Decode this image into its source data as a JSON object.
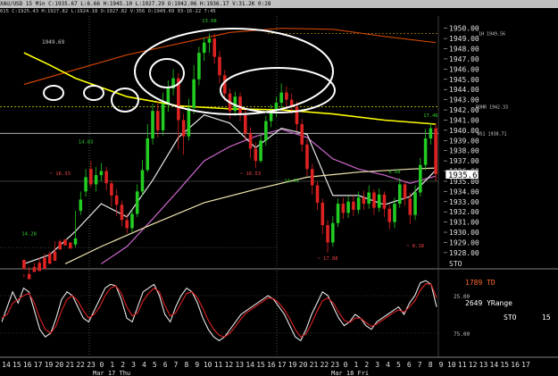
{
  "header": {
    "symbol_line": "XAU/USD 15 Min  C:1935.67  L:6.66  H:1945.10  L:1927.29  O:1942.06  H:1936.17  V:31.2K  0:28",
    "indicator_line": "615  C:1925.43  H:1927.82  L:1924.18  O:1927.82  V:356  O:1949.69  03-16-22  7:45"
  },
  "chart_data": [
    {
      "type": "candlestick",
      "yticks": [
        1950,
        1949,
        1948,
        1947,
        1946,
        1945,
        1944,
        1943,
        1942,
        1941,
        1940,
        1939,
        1938,
        1937,
        1936,
        1935,
        1934,
        1933,
        1932,
        1931,
        1930,
        1929,
        1928
      ],
      "ytick_labels": [
        "1950.00",
        "1949.00",
        "1948.00",
        "1947.00",
        "1946.00",
        "1945.00",
        "1944.00",
        "1943.00",
        "1942.00",
        "1941.00",
        "1940.00",
        "1939.00",
        "1938.00",
        "1937.00",
        "1936.00",
        "1935.00",
        "1934.00",
        "1933.00",
        "1932.00",
        "1931.00",
        "1930.00",
        "1929.00",
        "1928.00"
      ],
      "ylim": [
        1926.5,
        1951.2
      ],
      "last_price": "1935.67",
      "candles": [
        [
          1927.3,
          1926.4,
          1925.6,
          1925.9
        ],
        [
          1925.9,
          1925.4,
          1925.8,
          1926.6
        ],
        [
          1926.6,
          1926.1,
          1926.4,
          1927.0
        ],
        [
          1927.0,
          1926.2,
          1926.6,
          1927.5
        ],
        [
          1927.5,
          1926.4,
          1926.8,
          1927.9
        ],
        [
          1927.9,
          1926.9,
          1927.2,
          1928.1
        ],
        [
          1928.1,
          1927.2,
          1927.6,
          1929.1
        ],
        [
          1929.1,
          1928.3,
          1928.5,
          1929.3
        ],
        [
          1929.3,
          1928.7,
          1928.8,
          1929.0
        ],
        [
          1929.0,
          1928.4,
          1928.6,
          1928.8
        ],
        [
          1928.8,
          1929.4,
          1928.5,
          1932.1
        ],
        [
          1932.1,
          1933.2,
          1931.7,
          1934.0
        ],
        [
          1934.0,
          1935.4,
          1933.5,
          1936.2
        ],
        [
          1936.2,
          1934.7,
          1934.4,
          1937.0
        ],
        [
          1934.7,
          1935.6,
          1934.0,
          1936.4
        ],
        [
          1935.6,
          1936.0,
          1935.0,
          1936.8
        ],
        [
          1936.0,
          1934.8,
          1934.1,
          1936.4
        ],
        [
          1934.8,
          1933.6,
          1932.5,
          1935.1
        ],
        [
          1933.6,
          1932.7,
          1931.6,
          1934.2
        ],
        [
          1932.7,
          1931.2,
          1930.6,
          1933.1
        ],
        [
          1931.2,
          1930.4,
          1929.9,
          1931.8
        ],
        [
          1930.4,
          1931.8,
          1930.0,
          1932.2
        ],
        [
          1931.8,
          1934.0,
          1931.5,
          1934.7
        ],
        [
          1934.0,
          1936.1,
          1933.6,
          1937.1
        ],
        [
          1936.1,
          1939.2,
          1935.9,
          1940.6
        ],
        [
          1939.2,
          1941.9,
          1938.6,
          1942.6
        ],
        [
          1941.9,
          1940.0,
          1939.3,
          1942.8
        ],
        [
          1940.0,
          1942.6,
          1939.5,
          1943.7
        ],
        [
          1942.6,
          1944.1,
          1941.8,
          1944.9
        ],
        [
          1944.1,
          1945.1,
          1943.4,
          1946.0
        ],
        [
          1945.1,
          1941.0,
          1938.1,
          1945.6
        ],
        [
          1941.0,
          1939.4,
          1937.6,
          1941.6
        ],
        [
          1939.4,
          1942.2,
          1939.0,
          1943.1
        ],
        [
          1942.2,
          1945.0,
          1941.6,
          1946.4
        ],
        [
          1945.0,
          1947.6,
          1944.4,
          1948.2
        ],
        [
          1947.6,
          1948.6,
          1946.8,
          1949.1
        ],
        [
          1948.6,
          1949.0,
          1947.6,
          1949.5
        ],
        [
          1949.0,
          1947.2,
          1946.5,
          1949.5
        ],
        [
          1947.2,
          1945.4,
          1944.6,
          1947.8
        ],
        [
          1945.4,
          1943.6,
          1942.9,
          1945.9
        ],
        [
          1943.6,
          1941.9,
          1941.1,
          1944.1
        ],
        [
          1941.9,
          1943.3,
          1941.4,
          1943.8
        ],
        [
          1943.3,
          1941.5,
          1940.9,
          1943.7
        ],
        [
          1941.5,
          1939.7,
          1939.0,
          1942.0
        ],
        [
          1939.7,
          1938.2,
          1937.3,
          1940.3
        ],
        [
          1938.2,
          1937.0,
          1936.3,
          1938.8
        ],
        [
          1937.0,
          1939.0,
          1936.8,
          1939.6
        ],
        [
          1939.0,
          1940.9,
          1938.5,
          1941.4
        ],
        [
          1940.9,
          1941.9,
          1940.3,
          1942.5
        ],
        [
          1941.9,
          1942.7,
          1941.3,
          1943.3
        ],
        [
          1942.7,
          1943.7,
          1942.1,
          1944.6
        ],
        [
          1943.7,
          1943.0,
          1942.3,
          1944.3
        ],
        [
          1943.0,
          1942.3,
          1941.6,
          1943.6
        ],
        [
          1942.3,
          1940.6,
          1939.9,
          1942.8
        ],
        [
          1940.6,
          1938.6,
          1937.9,
          1941.1
        ],
        [
          1938.6,
          1936.2,
          1935.5,
          1939.1
        ],
        [
          1936.2,
          1934.6,
          1933.7,
          1936.7
        ],
        [
          1934.6,
          1932.9,
          1932.2,
          1935.0
        ],
        [
          1932.9,
          1930.7,
          1929.8,
          1933.3
        ],
        [
          1930.7,
          1929.0,
          1928.0,
          1931.2
        ],
        [
          1929.0,
          1930.9,
          1928.6,
          1931.6
        ],
        [
          1930.9,
          1932.8,
          1930.5,
          1933.3
        ],
        [
          1932.8,
          1931.9,
          1931.3,
          1933.4
        ],
        [
          1931.9,
          1933.0,
          1931.4,
          1933.5
        ],
        [
          1933.0,
          1932.2,
          1931.6,
          1933.6
        ],
        [
          1932.2,
          1933.4,
          1931.8,
          1934.0
        ],
        [
          1933.4,
          1932.8,
          1932.2,
          1934.1
        ],
        [
          1932.8,
          1933.9,
          1932.3,
          1934.6
        ],
        [
          1933.9,
          1932.4,
          1931.7,
          1934.2
        ],
        [
          1932.4,
          1933.7,
          1932.0,
          1934.3
        ],
        [
          1933.7,
          1932.3,
          1931.5,
          1934.0
        ],
        [
          1932.3,
          1931.0,
          1930.3,
          1932.7
        ],
        [
          1931.0,
          1932.8,
          1930.4,
          1933.4
        ],
        [
          1932.8,
          1934.7,
          1932.4,
          1935.3
        ],
        [
          1934.7,
          1933.3,
          1932.6,
          1935.0
        ],
        [
          1933.3,
          1931.7,
          1930.8,
          1933.9
        ],
        [
          1931.7,
          1933.9,
          1931.2,
          1934.6
        ],
        [
          1933.9,
          1936.6,
          1933.5,
          1937.3
        ],
        [
          1936.6,
          1939.2,
          1936.1,
          1940.1
        ],
        [
          1939.2,
          1940.2,
          1938.6,
          1940.7
        ],
        [
          1940.2,
          1935.7,
          1935.0,
          1940.6
        ]
      ],
      "value_labels": [
        {
          "text": "14.28",
          "i": 1,
          "price": 1929.7
        },
        {
          "text": "14.83",
          "i": 12,
          "price": 1938.7
        },
        {
          "text": "13.08",
          "i": 36,
          "price": 1950.6
        },
        {
          "text": "~ 16.33",
          "i": 7,
          "price": 1935.6
        },
        {
          "text": "~ 16.53",
          "i": 44,
          "price": 1935.6
        },
        {
          "text": "14.01",
          "i": 52,
          "price": 1934.9
        },
        {
          "text": "~ 17.88",
          "i": 59,
          "price": 1927.3
        },
        {
          "text": "6.68",
          "i": 72,
          "price": 1935.8
        },
        {
          "text": "~ 8.18",
          "i": 76,
          "price": 1928.5
        },
        {
          "text": "17.46",
          "i": 79,
          "price": 1941.3
        }
      ],
      "top_left_note": "1949.69",
      "level_labels": [
        {
          "text": "1H 1949.56",
          "price": 1949.5
        },
        {
          "text": "BOHR 1942.33",
          "price": 1942.3
        },
        {
          "text": "WS1 1938.71",
          "price": 1939.7
        }
      ],
      "moving_averages": [
        {
          "color": "#cc4400",
          "points": [
            [
              0,
              1944.5
            ],
            [
              20,
              1947.4
            ],
            [
              40,
              1949.6
            ],
            [
              50,
              1950.0
            ],
            [
              60,
              1949.9
            ],
            [
              70,
              1949.2
            ],
            [
              80,
              1948.6
            ]
          ]
        },
        {
          "color": "#ffff00",
          "points": [
            [
              0,
              1947.6
            ],
            [
              5,
              1946.4
            ],
            [
              10,
              1945.1
            ],
            [
              20,
              1943.3
            ],
            [
              30,
              1942.4
            ],
            [
              40,
              1942.1
            ],
            [
              50,
              1942.0
            ],
            [
              60,
              1941.6
            ],
            [
              70,
              1941.0
            ],
            [
              80,
              1940.6
            ]
          ]
        },
        {
          "color": "#cc66cc",
          "points": [
            [
              15,
              1926.9
            ],
            [
              20,
              1928.6
            ],
            [
              25,
              1931.3
            ],
            [
              30,
              1934.1
            ],
            [
              35,
              1937.0
            ],
            [
              40,
              1938.4
            ],
            [
              45,
              1939.4
            ],
            [
              50,
              1940.1
            ],
            [
              55,
              1939.3
            ],
            [
              60,
              1937.2
            ],
            [
              65,
              1936.2
            ],
            [
              70,
              1935.6
            ],
            [
              75,
              1934.8
            ],
            [
              80,
              1935.5
            ]
          ]
        },
        {
          "color": "#e8e8e8",
          "points": [
            [
              0,
              1926.9
            ],
            [
              5,
              1927.8
            ],
            [
              10,
              1930.1
            ],
            [
              15,
              1932.8
            ],
            [
              20,
              1931.5
            ],
            [
              25,
              1935.1
            ],
            [
              30,
              1939.3
            ],
            [
              35,
              1941.5
            ],
            [
              40,
              1940.7
            ],
            [
              45,
              1938.3
            ],
            [
              50,
              1940.2
            ],
            [
              55,
              1939.6
            ],
            [
              60,
              1933.6
            ],
            [
              65,
              1933.6
            ],
            [
              70,
              1932.7
            ],
            [
              75,
              1933.5
            ],
            [
              80,
              1936.1
            ]
          ]
        },
        {
          "color": "#f0e6b0",
          "points": [
            [
              8,
              1926.9
            ],
            [
              15,
              1928.6
            ],
            [
              25,
              1930.8
            ],
            [
              35,
              1932.9
            ],
            [
              45,
              1934.2
            ],
            [
              55,
              1935.4
            ],
            [
              65,
              1935.9
            ],
            [
              75,
              1936.2
            ],
            [
              80,
              1936.3
            ]
          ]
        }
      ]
    },
    {
      "type": "line",
      "name_label": "STO",
      "name_value": "15",
      "right_ticks": [
        "25.00",
        "75.00"
      ],
      "texts": [
        "1789 TD",
        "2649 YRange"
      ],
      "ylim": [
        100,
        0
      ],
      "series": [
        {
          "color": "#e8e8e8",
          "values": [
            60,
            40,
            20,
            35,
            15,
            20,
            45,
            70,
            80,
            75,
            55,
            30,
            20,
            25,
            40,
            55,
            60,
            45,
            30,
            15,
            10,
            12,
            30,
            55,
            60,
            40,
            20,
            15,
            10,
            25,
            50,
            60,
            40,
            25,
            15,
            20,
            35,
            55,
            70,
            80,
            85,
            80,
            70,
            60,
            50,
            45,
            40,
            35,
            30,
            25,
            30,
            40,
            50,
            65,
            80,
            85,
            70,
            50,
            35,
            20,
            25,
            40,
            55,
            65,
            60,
            50,
            55,
            65,
            70,
            60,
            55,
            50,
            45,
            40,
            50,
            35,
            25,
            8,
            5,
            10,
            40
          ]
        },
        {
          "color": "#dd2222",
          "values": [
            55,
            50,
            35,
            30,
            25,
            22,
            35,
            55,
            70,
            75,
            65,
            45,
            30,
            25,
            32,
            45,
            55,
            50,
            40,
            25,
            15,
            12,
            22,
            40,
            52,
            48,
            32,
            22,
            15,
            20,
            38,
            52,
            48,
            35,
            22,
            20,
            28,
            42,
            58,
            70,
            78,
            80,
            75,
            66,
            56,
            48,
            43,
            38,
            33,
            28,
            29,
            35,
            44,
            56,
            70,
            80,
            76,
            62,
            46,
            32,
            28,
            35,
            47,
            58,
            61,
            55,
            55,
            61,
            66,
            63,
            58,
            53,
            48,
            44,
            47,
            40,
            32,
            18,
            9,
            10,
            28
          ]
        }
      ]
    }
  ],
  "xaxis": {
    "hour_labels": [
      "14",
      "15",
      "16",
      "17",
      "19",
      "20",
      "21",
      "22",
      "23",
      "0",
      "1",
      "2",
      "3",
      "4",
      "5",
      "6",
      "7",
      "8",
      "9",
      "10",
      "11",
      "12",
      "13",
      "14",
      "15",
      "16",
      "17",
      "19",
      "20",
      "21",
      "22",
      "23",
      "0",
      "1",
      "2",
      "3",
      "4",
      "5",
      "6",
      "7",
      "8",
      "9",
      "10",
      "11",
      "12",
      "13",
      "14",
      "15",
      "16",
      "17"
    ],
    "day_labels": [
      "Mar 17 Thu",
      "Mar 18 Fri"
    ],
    "day_positions": [
      9,
      32
    ]
  },
  "right_axis_tag": "STO"
}
